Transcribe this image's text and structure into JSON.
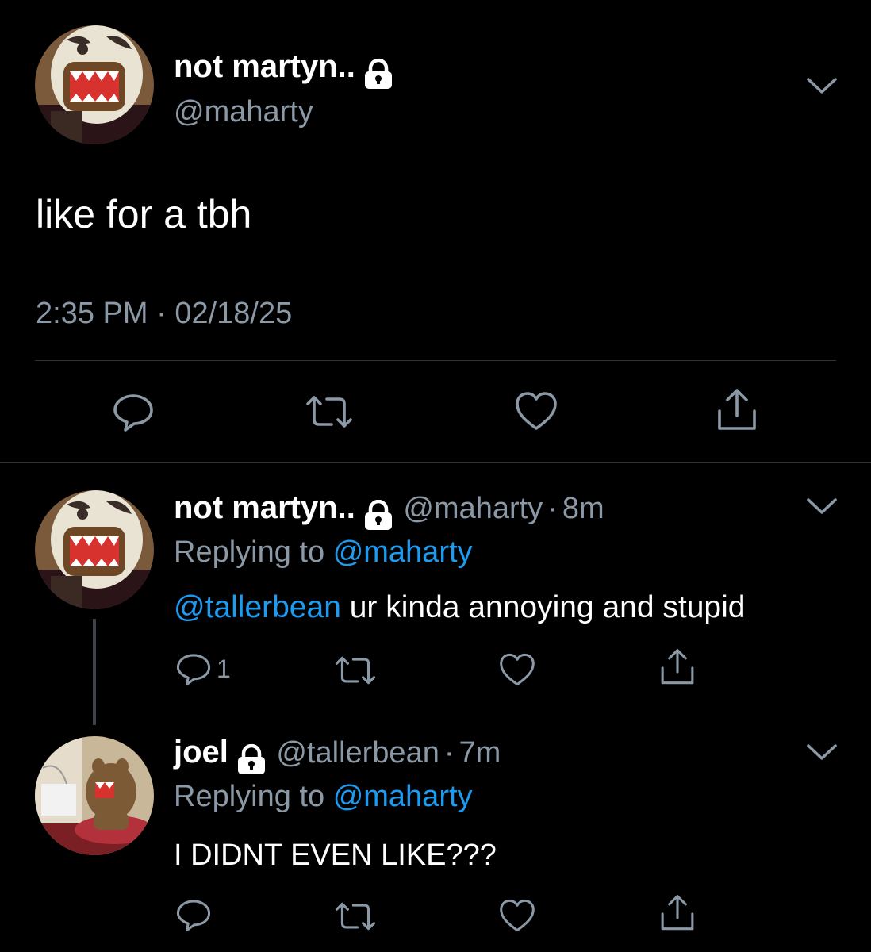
{
  "main_tweet": {
    "display_name": "not martyn..",
    "handle": "@maharty",
    "text": "like for a tbh",
    "time": "2:35 PM",
    "separator": "·",
    "date": "02/18/25"
  },
  "reply1": {
    "display_name": "not martyn..",
    "handle": "@maharty",
    "dot": "·",
    "age": "8m",
    "replying_prefix": "Replying to",
    "replying_to": "@maharty",
    "mention": "@tallerbean",
    "text": " ur kinda annoying and stupid",
    "reply_count": "1"
  },
  "reply2": {
    "display_name": "joel",
    "handle": "@tallerbean",
    "dot": "·",
    "age": "7m",
    "replying_prefix": "Replying to",
    "replying_to": "@maharty",
    "text": "I DIDNT EVEN LIKE???"
  },
  "colors": {
    "background": "#000000",
    "text": "#ffffff",
    "muted": "#8b98a5",
    "link": "#1d9bf0",
    "divider": "#2f3336"
  },
  "icons": [
    "lock-icon",
    "chevron-down-icon",
    "reply-icon",
    "retweet-icon",
    "like-icon",
    "share-icon"
  ]
}
